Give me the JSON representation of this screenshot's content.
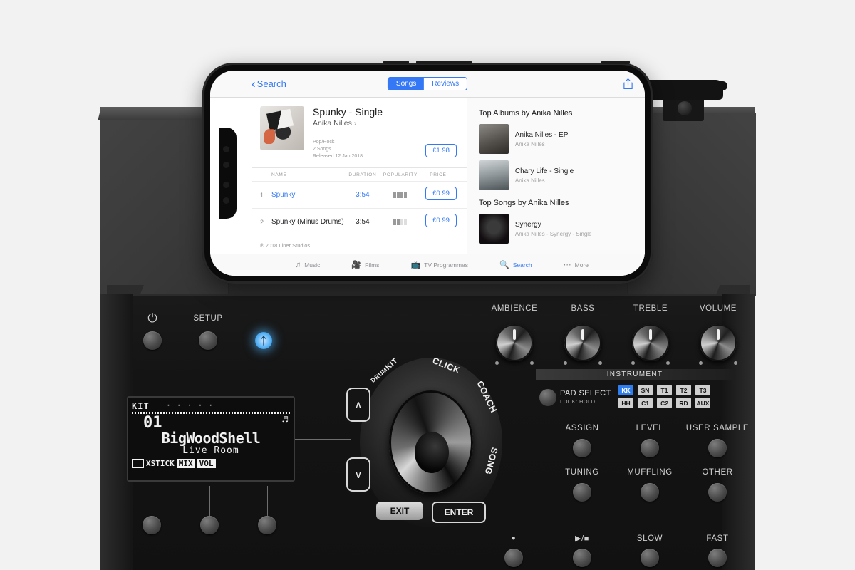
{
  "phone_app": {
    "nav": {
      "back_label": "Search",
      "back_icon": "chevron-left-icon",
      "segments": [
        {
          "label": "Songs",
          "selected": true
        },
        {
          "label": "Reviews",
          "selected": false
        }
      ],
      "share_icon": "share-icon"
    },
    "album": {
      "title": "Spunky - Single",
      "artist": "Anika Nilles",
      "artist_arrow": "›",
      "genre": "Pop/Rock",
      "song_count": "2 Songs",
      "released": "Released 12 Jan 2018",
      "price": "£1.98"
    },
    "track_table": {
      "columns": [
        "NAME",
        "DURATION",
        "POPULARITY",
        "PRICE"
      ],
      "rows": [
        {
          "num": "1",
          "name": "Spunky",
          "duration": "3:54",
          "popularity": 4,
          "price": "£0.99",
          "highlighted": true
        },
        {
          "num": "2",
          "name": "Spunky (Minus Drums)",
          "duration": "3:54",
          "popularity": 2,
          "price": "£0.99",
          "highlighted": false
        }
      ]
    },
    "copyright": "℗ 2018 Liner Studios",
    "top_albums": {
      "heading": "Top Albums by Anika Nilles",
      "items": [
        {
          "name": "Anika Nilles - EP",
          "sub": "Anika Nilles"
        },
        {
          "name": "Chary Life - Single",
          "sub": "Anika Nilles"
        }
      ]
    },
    "top_songs": {
      "heading": "Top Songs by Anika Nilles",
      "items": [
        {
          "name": "Synergy",
          "sub": "Anika Nilles - Synergy - Single"
        }
      ]
    },
    "tabbar": [
      {
        "label": "Music",
        "icon": "music-note-icon",
        "active": false
      },
      {
        "label": "Films",
        "icon": "film-icon",
        "active": false
      },
      {
        "label": "TV Programmes",
        "icon": "tv-icon",
        "active": false
      },
      {
        "label": "Search",
        "icon": "search-icon",
        "active": true
      },
      {
        "label": "More",
        "icon": "ellipsis-icon",
        "active": false
      }
    ],
    "accent_color": "#3478f6"
  },
  "drum_module": {
    "power_icon": "power-icon",
    "setup_label": "SETUP",
    "bluetooth_icon": "bluetooth-icon",
    "bluetooth_color": "#5ab4f5",
    "knobs": [
      {
        "label": "AMBIENCE"
      },
      {
        "label": "BASS"
      },
      {
        "label": "TREBLE"
      },
      {
        "label": "VOLUME"
      }
    ],
    "lcd": {
      "kit_label": "KIT",
      "dots": "· · · · ·",
      "kit_number": "01",
      "kit_name": "BigWoodShell",
      "room": "Live Room",
      "note_icon": "music-note-icon",
      "xstick_label": "XSTICK",
      "mix_label": "MIX",
      "vol_label": "VOL"
    },
    "wheel": {
      "drum_prefix": "DRUM",
      "drum_kit": "KIT",
      "click": "CLICK",
      "coach": "COACH",
      "song": "SONG",
      "exit": "EXIT",
      "enter": "ENTER",
      "up_icon": "chevron-up-icon",
      "down_icon": "chevron-down-icon"
    },
    "instrument": {
      "header": "INSTRUMENT",
      "pad_select_label": "PAD SELECT",
      "lock_label": "LOCK: HOLD",
      "pads_row1": [
        {
          "label": "KK",
          "active": true
        },
        {
          "label": "SN",
          "active": false
        },
        {
          "label": "T1",
          "active": false
        },
        {
          "label": "T2",
          "active": false
        },
        {
          "label": "T3",
          "active": false
        }
      ],
      "pads_row2": [
        {
          "label": "HH",
          "active": false
        },
        {
          "label": "C1",
          "active": false
        },
        {
          "label": "C2",
          "active": false
        },
        {
          "label": "RD",
          "active": false
        },
        {
          "label": "AUX",
          "active": false
        }
      ],
      "active_color": "#2f7ef0"
    },
    "param_buttons": [
      {
        "label": "ASSIGN"
      },
      {
        "label": "LEVEL"
      },
      {
        "label": "USER SAMPLE"
      },
      {
        "label": "TUNING"
      },
      {
        "label": "MUFFLING"
      },
      {
        "label": "OTHER"
      }
    ],
    "transport": [
      {
        "label": "●",
        "name": "record"
      },
      {
        "label": "▶/■",
        "name": "play-stop"
      },
      {
        "label": "SLOW",
        "name": "slow"
      },
      {
        "label": "FAST",
        "name": "fast"
      }
    ]
  }
}
